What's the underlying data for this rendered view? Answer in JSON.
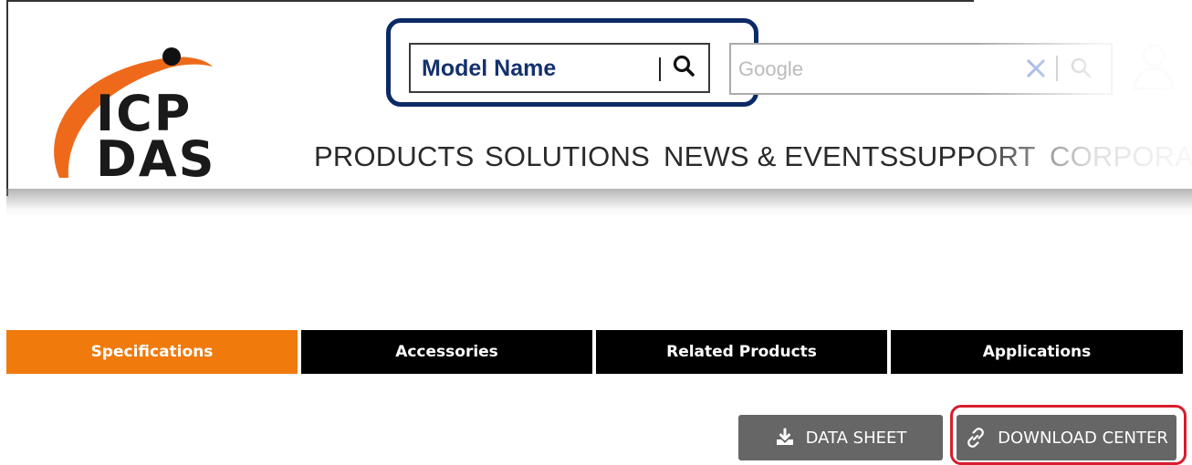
{
  "header": {
    "logo_text_line1": "ICP",
    "logo_text_line2": "DAS",
    "model_search": {
      "placeholder": "Model Name"
    },
    "google_search": {
      "placeholder": "Google"
    },
    "nav": [
      {
        "label": "PRODUCTS"
      },
      {
        "label": "SOLUTIONS"
      },
      {
        "label": "NEWS & EVENTS"
      },
      {
        "label": "SUPPORT"
      },
      {
        "label": "CORPORA"
      }
    ]
  },
  "tabs": [
    {
      "label": "Specifications",
      "active": true
    },
    {
      "label": "Accessories",
      "active": false
    },
    {
      "label": "Related Products",
      "active": false
    },
    {
      "label": "Applications",
      "active": false
    }
  ],
  "actions": {
    "data_sheet_label": "DATA SHEET",
    "download_center_label": "DOWNLOAD CENTER"
  },
  "colors": {
    "brand_orange": "#f07a0c",
    "highlight_blue": "#0b2a66",
    "highlight_red": "#d71d2c",
    "tab_black": "#000000",
    "button_gray": "#666666"
  },
  "icons": [
    "search-icon",
    "clear-icon",
    "user-icon",
    "download-icon",
    "link-icon"
  ]
}
